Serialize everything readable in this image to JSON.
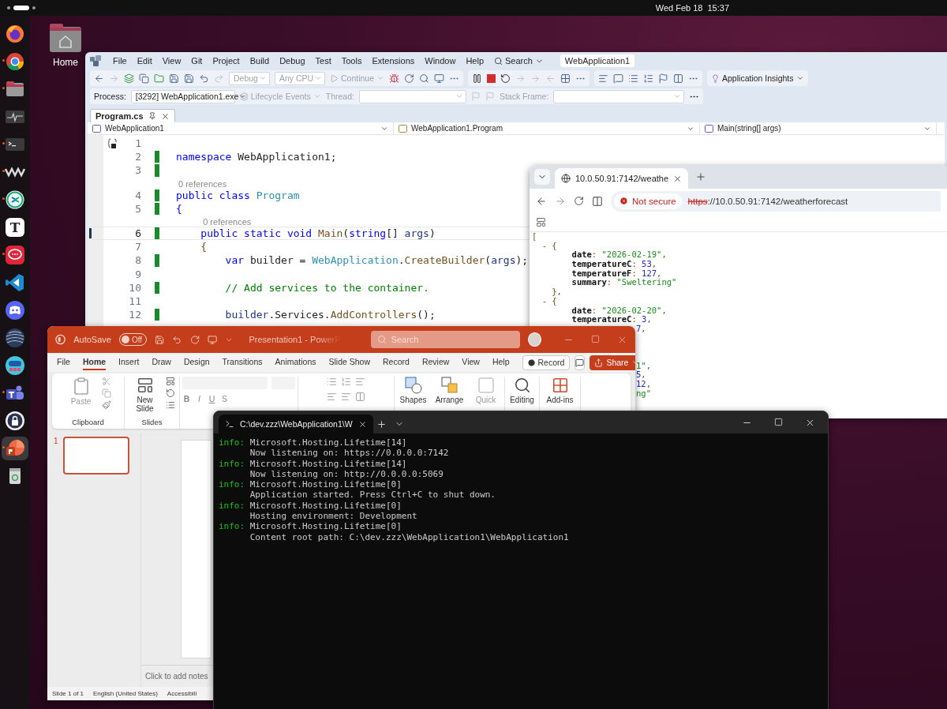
{
  "top_bar": {
    "date": "Wed Feb 18",
    "time": "15:37"
  },
  "dock": [
    {
      "kind": "fox",
      "running": false,
      "selected": false
    },
    {
      "kind": "ring",
      "running": true,
      "selected": false
    },
    {
      "kind": "folder",
      "running": true,
      "selected": false
    },
    {
      "kind": "pulse",
      "running": false,
      "selected": false
    },
    {
      "kind": "terminal",
      "running": true,
      "selected": false
    },
    {
      "kind": "waves",
      "running": true,
      "selected": false
    },
    {
      "kind": "arrows",
      "running": true,
      "selected": false
    },
    {
      "kind": "letter",
      "label": "T",
      "running": false,
      "selected": false
    },
    {
      "kind": "chat",
      "running": true,
      "selected": false
    },
    {
      "kind": "code",
      "running": false,
      "selected": false
    },
    {
      "kind": "controller",
      "running": false,
      "selected": false
    },
    {
      "kind": "sphere",
      "running": false,
      "selected": false
    },
    {
      "kind": "gamepad",
      "running": false,
      "selected": false
    },
    {
      "kind": "people",
      "running": true,
      "selected": false
    },
    {
      "kind": "lock",
      "running": false,
      "selected": false
    },
    {
      "kind": "slides",
      "running": true,
      "selected": true
    },
    {
      "kind": "trash",
      "running": false,
      "selected": false
    }
  ],
  "desktop_icons": [
    {
      "label": "Home"
    }
  ],
  "ide": {
    "menu": [
      "File",
      "Edit",
      "View",
      "Git",
      "Project",
      "Build",
      "Debug",
      "Test",
      "Tools",
      "Extensions",
      "Window",
      "Help"
    ],
    "search": "Search",
    "solution": "WebApplication1",
    "toolbar": {
      "configuration": "Debug",
      "platform": "Any CPU",
      "continue": "Continue",
      "insights": "Application Insights"
    },
    "debug_bar": {
      "process_label": "Process:",
      "process": "[3292] WebApplication1.exe",
      "lifecycle": "Lifecycle Events",
      "thread_label": "Thread:",
      "stack_label": "Stack Frame:"
    },
    "tabs": [
      {
        "label": "Program.cs",
        "selected": true
      }
    ],
    "nav": [
      "WebApplication1",
      "WebApplication1.Program",
      "Main(string[] args)"
    ],
    "code": [
      {
        "num": "1",
        "changed": false,
        "current": false
      },
      {
        "num": "2",
        "changed": true,
        "current": false,
        "tokens": [
          {
            "t": "namespace",
            "kind": "kw"
          },
          {
            "t": " WebApplication1;",
            "kind": "plain"
          }
        ]
      },
      {
        "num": "3",
        "changed": true,
        "current": false
      },
      {
        "num": "4",
        "changed": true,
        "current": false,
        "codelens": "0 references",
        "tokens": [
          {
            "t": "public class ",
            "kind": "kw"
          },
          {
            "t": "Program",
            "kind": "type"
          }
        ]
      },
      {
        "num": "5",
        "changed": true,
        "current": false,
        "tokens": [
          {
            "t": "{",
            "kind": "kw"
          }
        ]
      },
      {
        "num": "6",
        "changed": true,
        "current": true,
        "codelens": "0 references",
        "tokens": [
          {
            "t": "    public static void ",
            "kind": "kw"
          },
          {
            "t": "Main",
            "kind": "method"
          },
          {
            "t": "(",
            "kind": "plain"
          },
          {
            "t": "string",
            "kind": "kw"
          },
          {
            "t": "[] ",
            "kind": "plain"
          },
          {
            "t": "args",
            "kind": "param"
          },
          {
            "t": ")",
            "kind": "plain"
          }
        ]
      },
      {
        "num": "7",
        "changed": false,
        "current": false,
        "tokens": [
          {
            "t": "    {",
            "kind": "punct"
          }
        ]
      },
      {
        "num": "8",
        "changed": true,
        "current": false,
        "tokens": [
          {
            "t": "        var",
            "kind": "kw"
          },
          {
            "t": " builder = ",
            "kind": "plain"
          },
          {
            "t": "WebApplication",
            "kind": "type"
          },
          {
            "t": ".",
            "kind": "plain"
          },
          {
            "t": "CreateBuilder",
            "kind": "method"
          },
          {
            "t": "(",
            "kind": "plain"
          },
          {
            "t": "args",
            "kind": "param"
          },
          {
            "t": ");",
            "kind": "plain"
          }
        ]
      },
      {
        "num": "9",
        "changed": false,
        "current": false
      },
      {
        "num": "10",
        "changed": true,
        "current": false,
        "tokens": [
          {
            "t": "        // Add services to the container.",
            "kind": "comment"
          }
        ]
      },
      {
        "num": "11",
        "changed": false,
        "current": false
      },
      {
        "num": "12",
        "changed": true,
        "current": false,
        "tokens": [
          {
            "t": "        builder",
            "kind": "param"
          },
          {
            "t": ".Services.",
            "kind": "plain"
          },
          {
            "t": "AddControllers",
            "kind": "method"
          },
          {
            "t": "();",
            "kind": "plain"
          }
        ]
      }
    ]
  },
  "browser": {
    "tab": "10.0.50.91:7142/weathe",
    "security": "Not secure",
    "scheme": "https",
    "url_rest": "://10.0.50.91:7142/weatherforecast",
    "lines": [
      {
        "kind": "line",
        "tokens": [
          {
            "t": "[",
            "kind": "punct"
          }
        ]
      },
      {
        "kind": "line",
        "tokens": [
          {
            "t": "  - {",
            "kind": "punct"
          }
        ]
      },
      {
        "kind": "line",
        "tokens": [
          {
            "t": "        date",
            "kind": "key"
          },
          {
            "t": ": ",
            "kind": "punct"
          },
          {
            "t": "\"2026-02-19\"",
            "kind": "str"
          },
          {
            "t": ",",
            "kind": "punct"
          }
        ]
      },
      {
        "kind": "line",
        "tokens": [
          {
            "t": "        temperatureC",
            "kind": "key"
          },
          {
            "t": ": ",
            "kind": "punct"
          },
          {
            "t": "53",
            "kind": "num"
          },
          {
            "t": ",",
            "kind": "punct"
          }
        ]
      },
      {
        "kind": "line",
        "tokens": [
          {
            "t": "        temperatureF",
            "kind": "key"
          },
          {
            "t": ": ",
            "kind": "punct"
          },
          {
            "t": "127",
            "kind": "num"
          },
          {
            "t": ",",
            "kind": "punct"
          }
        ]
      },
      {
        "kind": "line",
        "tokens": [
          {
            "t": "        summary",
            "kind": "key"
          },
          {
            "t": ": ",
            "kind": "punct"
          },
          {
            "t": "\"Sweltering\"",
            "kind": "str"
          }
        ]
      },
      {
        "kind": "line",
        "tokens": [
          {
            "t": "    },",
            "kind": "punct"
          }
        ]
      },
      {
        "kind": "line",
        "tokens": [
          {
            "t": "  - {",
            "kind": "punct"
          }
        ]
      },
      {
        "kind": "line",
        "tokens": [
          {
            "t": "        date",
            "kind": "key"
          },
          {
            "t": ": ",
            "kind": "punct"
          },
          {
            "t": "\"2026-02-20\"",
            "kind": "str"
          },
          {
            "t": ",",
            "kind": "punct"
          }
        ]
      },
      {
        "kind": "line",
        "tokens": [
          {
            "t": "        temperatureC",
            "kind": "key"
          },
          {
            "t": ": ",
            "kind": "punct"
          },
          {
            "t": "3",
            "kind": "num"
          },
          {
            "t": ",",
            "kind": "punct"
          }
        ]
      },
      {
        "kind": "tail",
        "tokens": [
          {
            "t": "7",
            "kind": "num"
          },
          {
            "t": ",",
            "kind": "punct"
          }
        ]
      },
      {
        "kind": "blank"
      },
      {
        "kind": "blank"
      },
      {
        "kind": "blank"
      },
      {
        "kind": "tail",
        "tokens": [
          {
            "t": "1\"",
            "kind": "str"
          },
          {
            "t": ",",
            "kind": "punct"
          }
        ]
      },
      {
        "kind": "tail",
        "tokens": [
          {
            "t": "5",
            "kind": "num"
          },
          {
            "t": ",",
            "kind": "punct"
          }
        ]
      },
      {
        "kind": "tail",
        "tokens": [
          {
            "t": "12",
            "kind": "num"
          },
          {
            "t": ",",
            "kind": "punct"
          }
        ]
      },
      {
        "kind": "tail",
        "tokens": [
          {
            "t": "ng\"",
            "kind": "str"
          }
        ]
      }
    ]
  },
  "slides_app": {
    "autosave": "AutoSave",
    "autosave_toggle": {
      "label": "Off",
      "on": false
    },
    "title": "Presentation1 - PowerP",
    "search": "Search",
    "tabs": [
      {
        "label": "File",
        "selected": false
      },
      {
        "label": "Home",
        "selected": true
      },
      {
        "label": "Insert",
        "selected": false
      },
      {
        "label": "Draw",
        "selected": false
      },
      {
        "label": "Design",
        "selected": false
      },
      {
        "label": "Transitions",
        "selected": false
      },
      {
        "label": "Animations",
        "selected": false
      },
      {
        "label": "Slide Show",
        "selected": false
      },
      {
        "label": "Record",
        "selected": false
      },
      {
        "label": "Review",
        "selected": false
      },
      {
        "label": "View",
        "selected": false
      },
      {
        "label": "Help",
        "selected": false
      }
    ],
    "record": "Record",
    "share": "Share",
    "ribbon": {
      "paste": "Paste",
      "clipboard": "Clipboard",
      "new_slide": "New Slide",
      "slides": "Slides",
      "font_buttons": [
        "B",
        "I",
        "U",
        "S"
      ],
      "shapes": "Shapes",
      "arrange": "Arrange",
      "quick_styles": "Quick",
      "editing": "Editing",
      "addins": "Add-ins"
    },
    "thumbnails": [
      {
        "number": "1",
        "selected": true
      }
    ],
    "notes": "Click to add notes",
    "status": [
      "Slide 1 of 1",
      "English (United States)",
      "Accessibili"
    ]
  },
  "terminal": {
    "tab": "C:\\dev.zzz\\WebApplication1\\W",
    "lines": [
      {
        "kind": "log",
        "tag": "info:",
        "text": "Microsoft.Hosting.Lifetime[14]"
      },
      {
        "kind": "detail",
        "text": "Now listening on: https://0.0.0.0:7142"
      },
      {
        "kind": "log",
        "tag": "info:",
        "text": "Microsoft.Hosting.Lifetime[14]"
      },
      {
        "kind": "detail",
        "text": "Now listening on: http://0.0.0.0:5069"
      },
      {
        "kind": "log",
        "tag": "info:",
        "text": "Microsoft.Hosting.Lifetime[0]"
      },
      {
        "kind": "detail",
        "text": "Application started. Press Ctrl+C to shut down."
      },
      {
        "kind": "log",
        "tag": "info:",
        "text": "Microsoft.Hosting.Lifetime[0]"
      },
      {
        "kind": "detail",
        "text": "Hosting environment: Development"
      },
      {
        "kind": "log",
        "tag": "info:",
        "text": "Microsoft.Hosting.Lifetime[0]"
      },
      {
        "kind": "detail",
        "text": "Content root path: C:\\dev.zzz\\WebApplication1\\WebApplication1"
      }
    ]
  }
}
